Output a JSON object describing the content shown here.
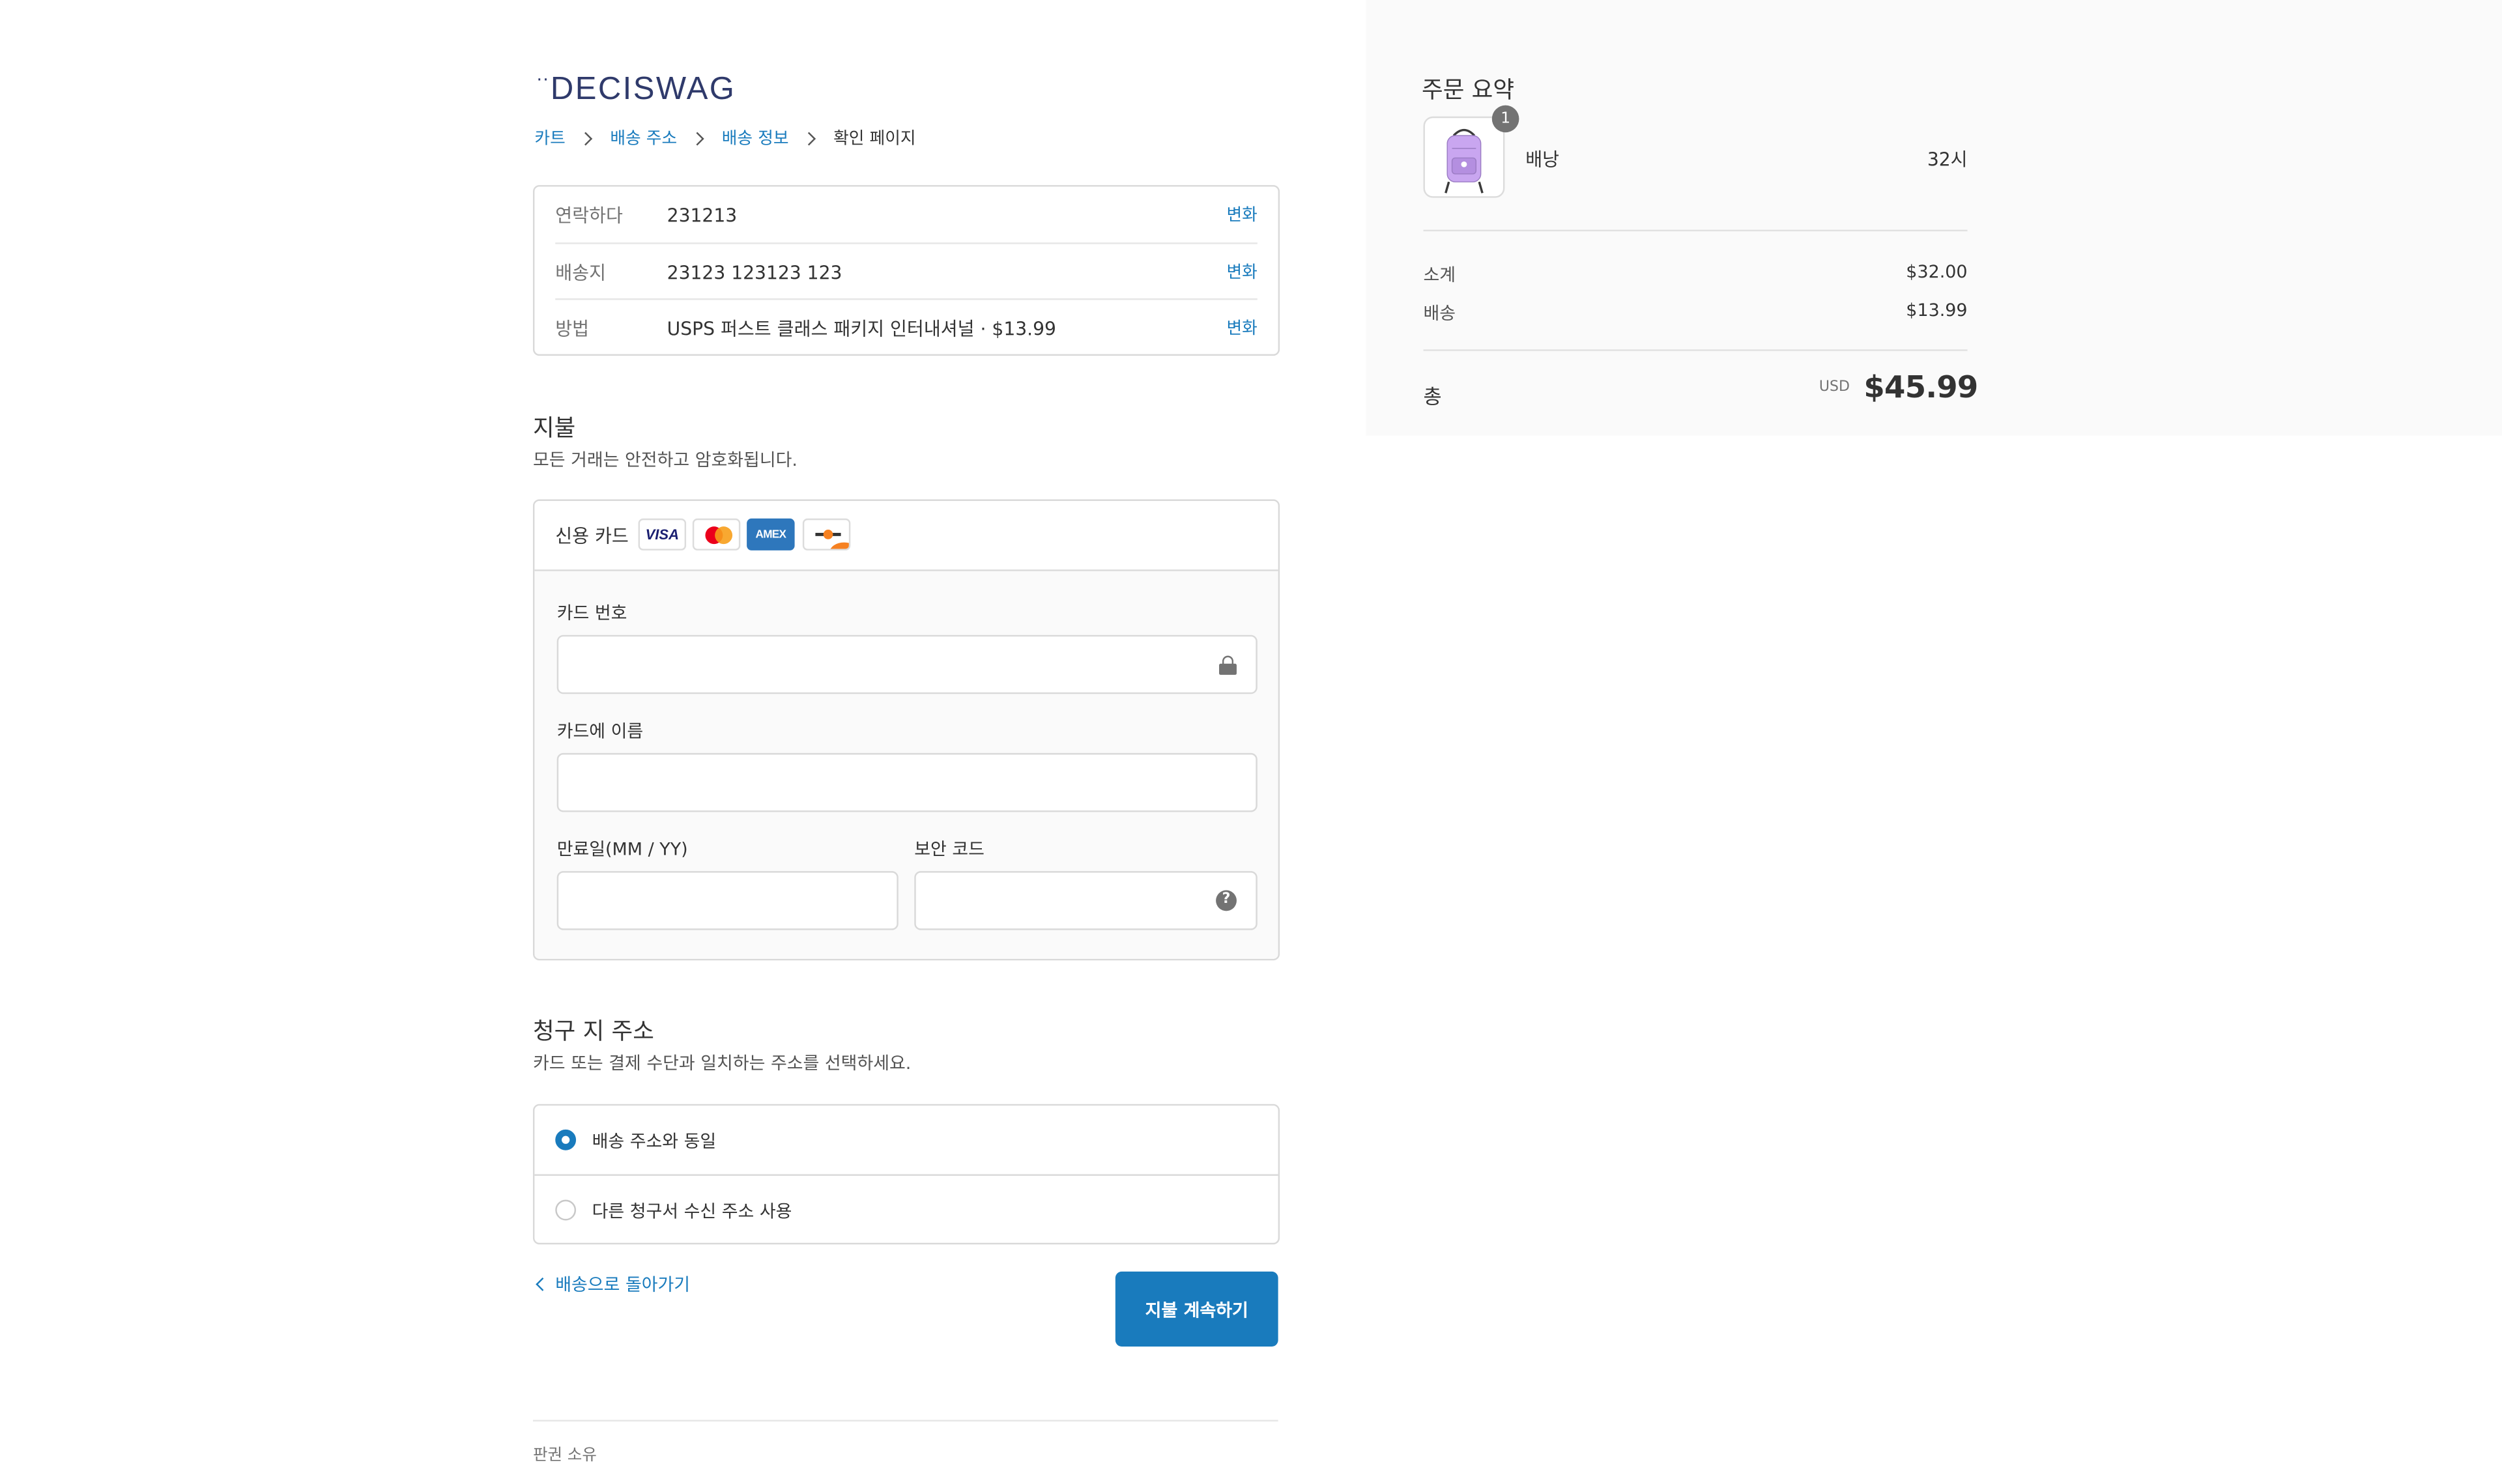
{
  "brand": {
    "logo_text": "DECISWAG"
  },
  "breadcrumb": [
    {
      "label": "카트"
    },
    {
      "label": "배송 주소"
    },
    {
      "label": "배송 정보"
    },
    {
      "label": "확인 페이지"
    }
  ],
  "review": {
    "rows": [
      {
        "label": "연락하다",
        "value": "231213",
        "action": "변화"
      },
      {
        "label": "배송지",
        "value": "23123 123123 123",
        "action": "변화"
      },
      {
        "label": "방법",
        "value": "USPS 퍼스트 클래스 패키지 인터내셔널 · $13.99",
        "action": "변화"
      }
    ]
  },
  "payment": {
    "title": "지불",
    "description": "모든 거래는 안전하고 암호화됩니다.",
    "method_label": "신용 카드",
    "card_brands": [
      "visa-logo",
      "mastercard-logo",
      "amex-logo",
      "discover-logo"
    ],
    "visa_text": "VISA",
    "amex_text": "AMEX",
    "fields": {
      "card_number": {
        "label": "카드 번호",
        "value": ""
      },
      "name_on_card": {
        "label": "카드에 이름",
        "value": ""
      },
      "expiry": {
        "label": "만료일(MM / YY)",
        "value": ""
      },
      "security_code": {
        "label": "보안 코드",
        "value": ""
      }
    }
  },
  "billing": {
    "title": "청구 지 주소",
    "description": "카드 또는 결제 수단과 일치하는 주소를 선택하세요.",
    "options": [
      {
        "label": "배송 주소와 동일",
        "selected": true
      },
      {
        "label": "다른 청구서 수신 주소 사용",
        "selected": false
      }
    ]
  },
  "actions": {
    "back_label": "배송으로 돌아가기",
    "continue_label": "지불 계속하기"
  },
  "footer": {
    "copyright": "판권 소유"
  },
  "summary": {
    "title": "주문 요약",
    "item": {
      "name": "배낭",
      "price": "32시",
      "quantity": "1"
    },
    "subtotal_label": "소계",
    "subtotal_value": "$32.00",
    "shipping_label": "배송",
    "shipping_value": "$13.99",
    "total_label": "총",
    "total_currency": "USD",
    "total_value": "$45.99"
  },
  "colors": {
    "accent": "#197bbd",
    "logo": "#2f3a6b",
    "summary_background": "#fafafa",
    "backpack": "#c9a6f0"
  }
}
